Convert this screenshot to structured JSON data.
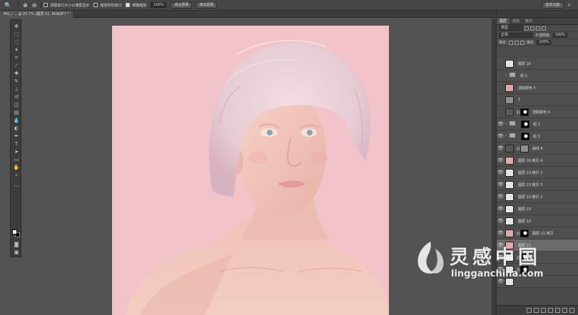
{
  "options_bar": {
    "zoom_tool_glyph": "🔍",
    "zoom_in_glyph": "⊕",
    "zoom_out_glyph": "⊖",
    "resize_windows_label": "调整窗口大小以满屏显示",
    "zoom_all_label": "缩放所有窗口",
    "scrubby_zoom_label": "细微缩放",
    "zoom_percent": "100%",
    "fit_screen_label": "适合屏幕",
    "fill_screen_label": "填充屏幕",
    "workspace_label": "基本功能",
    "search_glyph": "⌕"
  },
  "document_tab": {
    "title": "MG_/ ... @ 25.7% (图层 11, RGB/8*) *"
  },
  "layers_panel": {
    "tabs": [
      "图层",
      "通道",
      "路径"
    ],
    "kind_filter": "类型",
    "blend_mode": "正常",
    "opacity_label": "不透明度:",
    "opacity_value": "100%",
    "lock_label": "锁定:",
    "fill_label": "填充:",
    "fill_value": "100%",
    "layers": [
      {
        "name": "图层 16",
        "thumb": "checker",
        "visible": false,
        "kind": "layer"
      },
      {
        "name": "组 5",
        "thumb": "folder",
        "visible": false,
        "kind": "group"
      },
      {
        "name": "选取颜色 5",
        "thumb": "skin",
        "visible": false,
        "kind": "layer"
      },
      {
        "name": "2",
        "thumb": "grey",
        "visible": false,
        "kind": "layer"
      },
      {
        "name": "选取颜色 4",
        "thumb": "adj",
        "visible": false,
        "kind": "adjust-mask"
      },
      {
        "name": "组 1",
        "thumb": "folder",
        "visible": true,
        "kind": "group-mask"
      },
      {
        "name": "组 3",
        "thumb": "folder",
        "visible": true,
        "kind": "group-mask"
      },
      {
        "name": "曲线 4",
        "thumb": "adj",
        "visible": true,
        "kind": "curve"
      },
      {
        "name": "图层 16 拷贝 4",
        "thumb": "skin",
        "visible": true,
        "kind": "layer"
      },
      {
        "name": "图层 13 拷贝 3",
        "thumb": "checker",
        "visible": true,
        "kind": "layer"
      },
      {
        "name": "图层 13 拷贝 3",
        "thumb": "checker",
        "visible": true,
        "kind": "layer"
      },
      {
        "name": "图层 13 拷贝 2",
        "thumb": "checker",
        "visible": true,
        "kind": "layer"
      },
      {
        "name": "图层 13",
        "thumb": "checker",
        "visible": true,
        "kind": "layer"
      },
      {
        "name": "图层 12",
        "thumb": "checker",
        "visible": true,
        "kind": "layer"
      },
      {
        "name": "图层 11 拷贝",
        "thumb": "skin",
        "visible": true,
        "kind": "layer-mask"
      },
      {
        "name": "图层 11",
        "thumb": "skin",
        "visible": true,
        "kind": "layer",
        "selected": true
      },
      {
        "name": "",
        "thumb": "white",
        "visible": true,
        "kind": "layer-mask"
      },
      {
        "name": "",
        "thumb": "checker",
        "visible": true,
        "kind": "layer-mask"
      },
      {
        "name": "",
        "thumb": "checker",
        "visible": true,
        "kind": "layer"
      }
    ]
  },
  "watermark": {
    "chinese": "灵感中国",
    "english": "lingganchina.com"
  },
  "colors": {
    "canvas_pink": "#f2c3c9",
    "hair": "#ead2da",
    "skin": "#f2c7bd"
  }
}
